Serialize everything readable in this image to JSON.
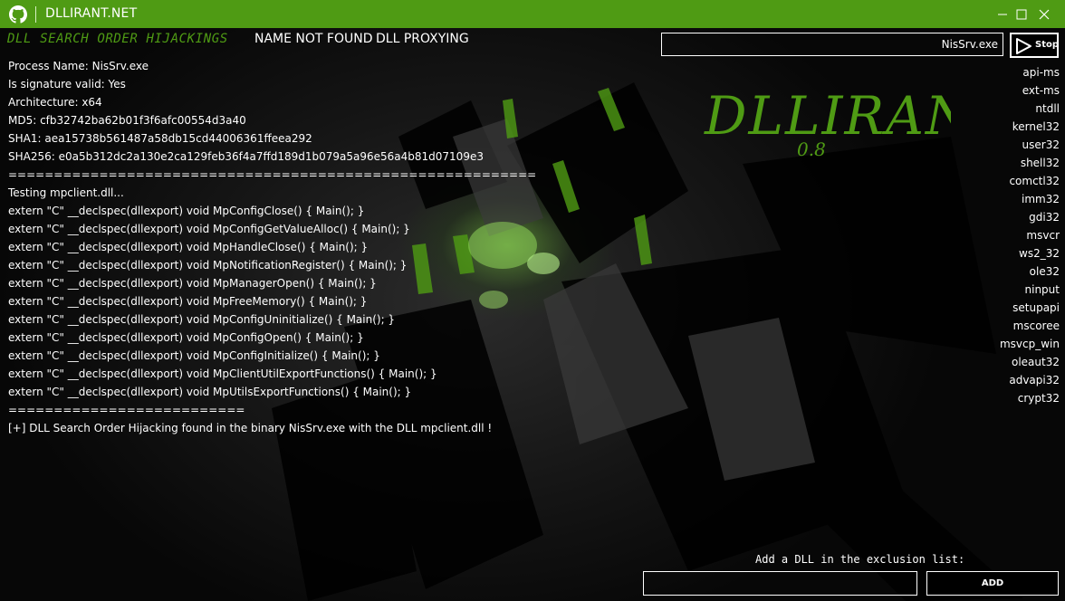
{
  "window": {
    "title": "DLLIRANT.NET",
    "accent": "#4f9b14"
  },
  "icons": {
    "app": "github-icon",
    "minimize": "minimize-icon",
    "maximize": "maximize-icon",
    "close": "close-icon",
    "stop": "play-icon"
  },
  "tabs": [
    {
      "label": "DLL SEARCH ORDER HIJACKINGS",
      "active": true
    },
    {
      "label": "NAME NOT FOUND",
      "active": false
    },
    {
      "label": "DLL PROXYING",
      "active": false
    }
  ],
  "process": {
    "value": "NisSrv.exe",
    "stop_label": "Stop"
  },
  "logo": {
    "name": "DLLIRANT",
    "version": "0.8"
  },
  "log": [
    "Process Name: NisSrv.exe",
    "Is signature valid: Yes",
    "Architecture: x64",
    "MD5: cfb32742ba62b01f3f6afc00554d3a40",
    "SHA1: aea15738b561487a58db15cd44006361ffeea292",
    "SHA256: e0a5b312dc2a130e2ca129feb36f4a7ffd189d1b079a5a96e56a4b81d07109e3",
    "==========================================================",
    "Testing mpclient.dll...",
    "extern \"C\" __declspec(dllexport) void MpConfigClose() { Main(); }",
    "extern \"C\" __declspec(dllexport) void MpConfigGetValueAlloc() { Main(); }",
    "extern \"C\" __declspec(dllexport) void MpHandleClose() { Main(); }",
    "extern \"C\" __declspec(dllexport) void MpNotificationRegister() { Main(); }",
    "extern \"C\" __declspec(dllexport) void MpManagerOpen() { Main(); }",
    "extern \"C\" __declspec(dllexport) void MpFreeMemory() { Main(); }",
    "extern \"C\" __declspec(dllexport) void MpConfigUninitialize() { Main(); }",
    "extern \"C\" __declspec(dllexport) void MpConfigOpen() { Main(); }",
    "extern \"C\" __declspec(dllexport) void MpConfigInitialize() { Main(); }",
    "extern \"C\" __declspec(dllexport) void MpClientUtilExportFunctions() { Main(); }",
    "extern \"C\" __declspec(dllexport) void MpUtilsExportFunctions() { Main(); }",
    "==========================",
    "[+] DLL Search Order Hijacking found in the binary NisSrv.exe with the DLL mpclient.dll !"
  ],
  "exclusion_list": [
    "api-ms",
    "ext-ms",
    "ntdll",
    "kernel32",
    "user32",
    "shell32",
    "comctl32",
    "imm32",
    "gdi32",
    "msvcr",
    "ws2_32",
    "ole32",
    "ninput",
    "setupapi",
    "mscoree",
    "msvcp_win",
    "oleaut32",
    "advapi32",
    "crypt32"
  ],
  "exclusion": {
    "label": "Add a DLL in the exclusion list:",
    "input_value": "",
    "add_label": "ADD"
  }
}
